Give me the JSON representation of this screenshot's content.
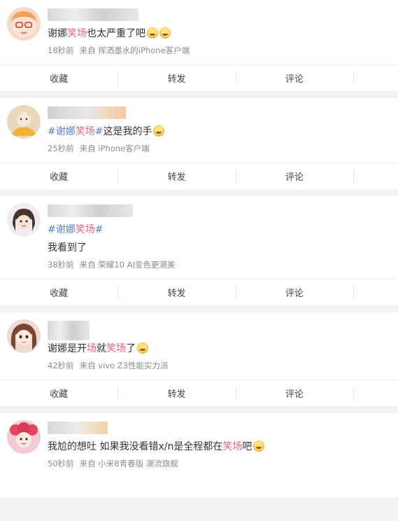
{
  "posts": [
    {
      "text_parts": [
        [
          "谢娜",
          ""
        ],
        [
          "笑场",
          "hl"
        ],
        [
          "也太严重了吧",
          ""
        ]
      ],
      "emoji": [
        "laugh-cry-emoji",
        "laugh-cry-emoji"
      ],
      "time": "18秒前",
      "source": "来自 挥洒墨水的iPhone客户端",
      "avatar_color": "#f7c4a8"
    },
    {
      "text_parts": [
        [
          "#谢娜",
          "tag"
        ],
        [
          "笑场",
          "hl"
        ],
        [
          "#",
          "tag"
        ],
        [
          "这是我的手",
          ""
        ]
      ],
      "emoji": [
        "cat-emoji"
      ],
      "time": "25秒前",
      "source": "来自 iPhone客户端",
      "avatar_color": "#e5cba6"
    },
    {
      "text_parts": [
        [
          "#谢娜",
          "tag"
        ],
        [
          "笑场",
          "hl"
        ],
        [
          "#",
          "tag"
        ]
      ],
      "second_line": "我看到了",
      "emoji": [],
      "time": "38秒前",
      "source": "来自 荣耀10 AI变色更潮美",
      "avatar_color": "#d7c3cf"
    },
    {
      "text_parts": [
        [
          "谢娜是开",
          ""
        ],
        [
          "场",
          "hl"
        ],
        [
          "就",
          ""
        ],
        [
          "笑场",
          "hl"
        ],
        [
          "了",
          ""
        ]
      ],
      "emoji": [
        "surprised-emoji"
      ],
      "time": "42秒前",
      "source": "来自 vivo Z3性能实力派",
      "avatar_color": "#c9a08e"
    },
    {
      "text_parts": [
        [
          "我尬的想吐 如果我没看错x/n是全程都在",
          ""
        ],
        [
          "笑场",
          "hl"
        ],
        [
          "吧",
          ""
        ]
      ],
      "emoji": [
        "sleepy-emoji"
      ],
      "time": "50秒前",
      "source": "来自 小米8青春版 潮流旗舰",
      "avatar_color": "#e38fa4"
    }
  ],
  "actions": {
    "favorite": "收藏",
    "repost": "转发",
    "comment": "评论"
  }
}
